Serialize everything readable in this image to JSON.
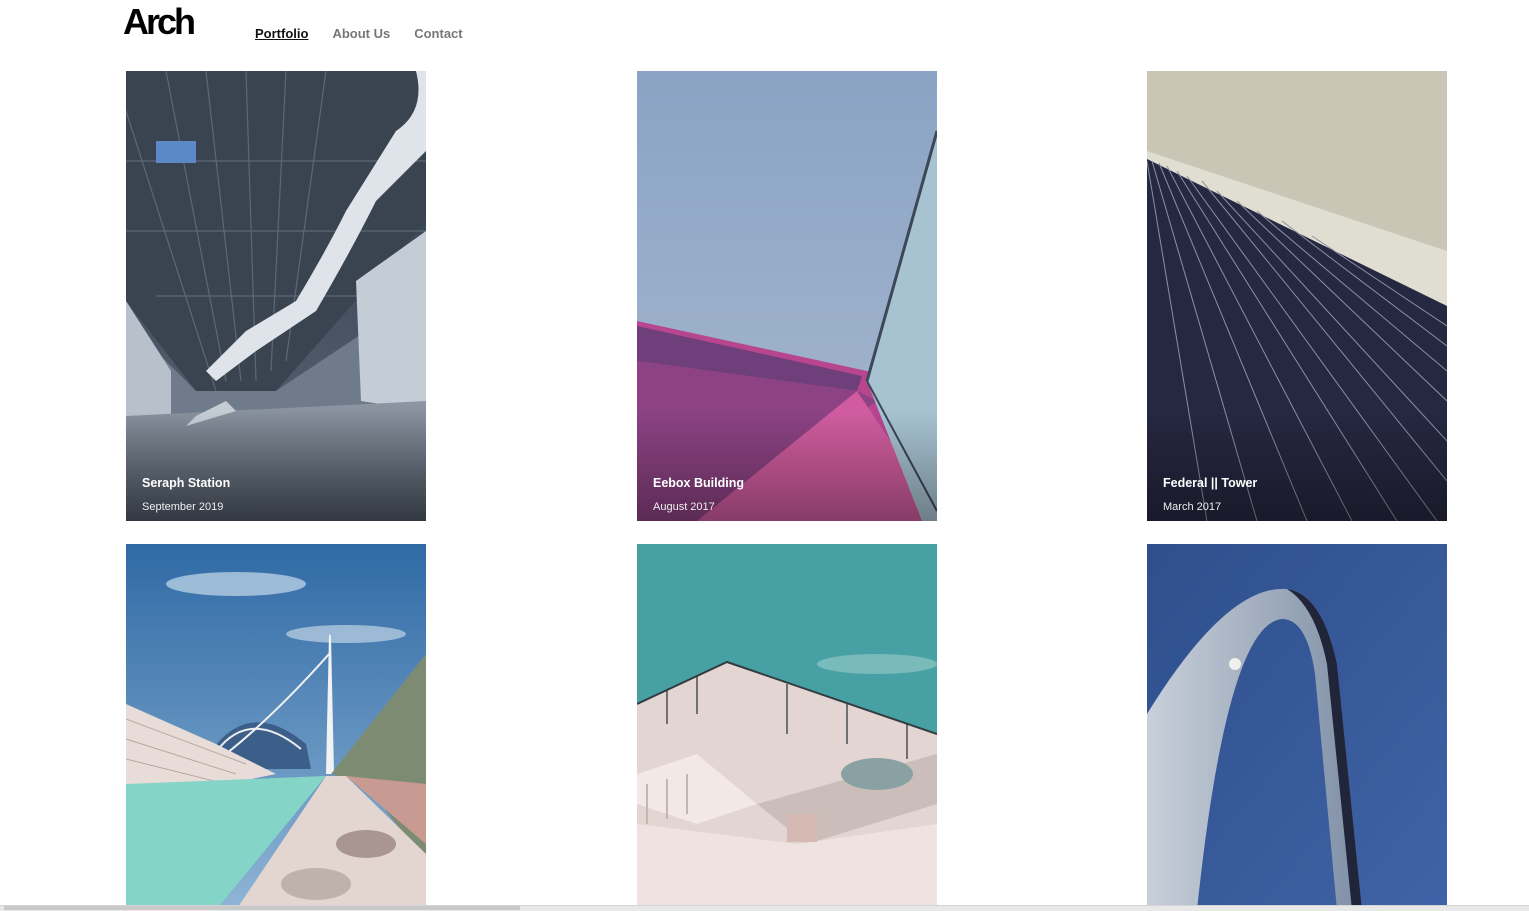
{
  "header": {
    "logo": "Arch",
    "nav": [
      {
        "label": "Portfolio",
        "active": true
      },
      {
        "label": "About Us",
        "active": false
      },
      {
        "label": "Contact",
        "active": false
      }
    ]
  },
  "projects": [
    {
      "title": "Seraph Station",
      "date": "September 2019"
    },
    {
      "title": "Eebox Building",
      "date": "August 2017"
    },
    {
      "title": "Federal || Tower",
      "date": "March 2017"
    },
    {
      "title": "",
      "date": ""
    },
    {
      "title": "",
      "date": ""
    },
    {
      "title": "",
      "date": ""
    }
  ]
}
